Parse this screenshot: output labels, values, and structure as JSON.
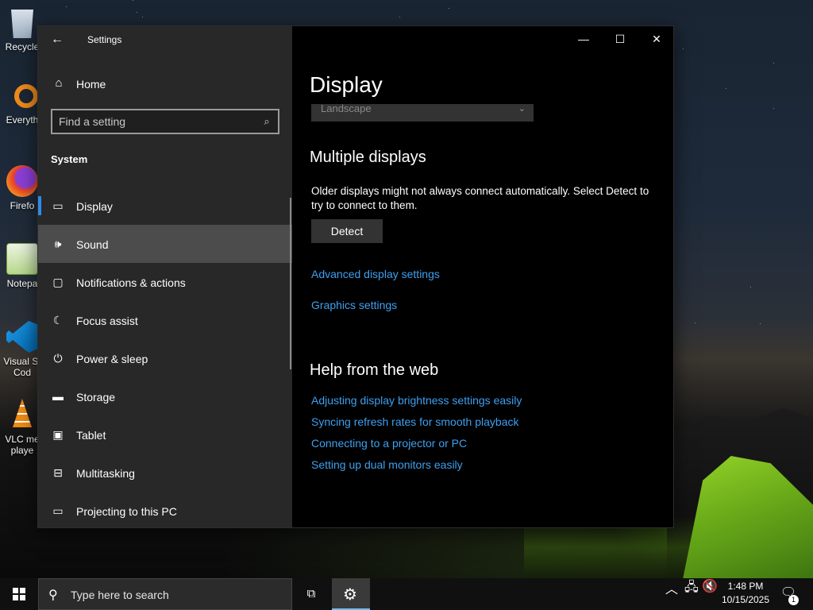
{
  "desktop": {
    "icons": [
      {
        "label": "Recycle",
        "icon": "recycle-bin-icon"
      },
      {
        "label": "Everyth",
        "icon": "everything-search-icon"
      },
      {
        "label": "Firefo",
        "icon": "firefox-icon"
      },
      {
        "label": "Notepa",
        "icon": "notepad-icon"
      },
      {
        "label": "Visual St Cod",
        "icon": "vscode-icon"
      },
      {
        "label": "VLC me playe",
        "icon": "vlc-icon"
      }
    ]
  },
  "window": {
    "title": "Settings",
    "back_glyph": "←",
    "minimize_glyph": "—",
    "maximize_glyph": "☐",
    "close_glyph": "✕"
  },
  "nav": {
    "home_label": "Home",
    "home_glyph": "⌂",
    "search_placeholder": "Find a setting",
    "search_glyph": "⌕",
    "section_label": "System",
    "items": [
      {
        "label": "Display",
        "glyph": "▭",
        "icon": "display-icon"
      },
      {
        "label": "Sound",
        "glyph": "🕪",
        "icon": "sound-icon"
      },
      {
        "label": "Notifications & actions",
        "glyph": "▢",
        "icon": "notifications-icon"
      },
      {
        "label": "Focus assist",
        "glyph": "☾",
        "icon": "focus-assist-icon"
      },
      {
        "label": "Power & sleep",
        "glyph": "⏻",
        "icon": "power-icon"
      },
      {
        "label": "Storage",
        "glyph": "▬",
        "icon": "storage-icon"
      },
      {
        "label": "Tablet",
        "glyph": "▣",
        "icon": "tablet-icon"
      },
      {
        "label": "Multitasking",
        "glyph": "⊟",
        "icon": "multitasking-icon"
      },
      {
        "label": "Projecting to this PC",
        "glyph": "▭",
        "icon": "projecting-icon"
      }
    ]
  },
  "content": {
    "title": "Display",
    "orientation_value": "Landscape",
    "dropdown_glyph": "⌄",
    "multiple_displays_heading": "Multiple displays",
    "multiple_displays_text": "Older displays might not always connect automatically. Select Detect to try to connect to them.",
    "detect_label": "Detect",
    "advanced_link": "Advanced display settings",
    "graphics_link": "Graphics settings",
    "help_heading": "Help from the web",
    "help_links": [
      "Adjusting display brightness settings easily",
      "Syncing refresh rates for smooth playback",
      "Connecting to a projector or PC",
      "Setting up dual monitors easily"
    ]
  },
  "taskbar": {
    "search_placeholder": "Type here to search",
    "search_glyph": "⚲",
    "taskview_glyph": "⧉",
    "settings_glyph": "⚙",
    "tray_up_glyph": "︿",
    "network_glyph": "🖧",
    "volume_glyph": "🔇",
    "time": "1:48 PM",
    "date": "10/15/2025",
    "notification_glyph": "🗨",
    "notification_count": "1"
  }
}
